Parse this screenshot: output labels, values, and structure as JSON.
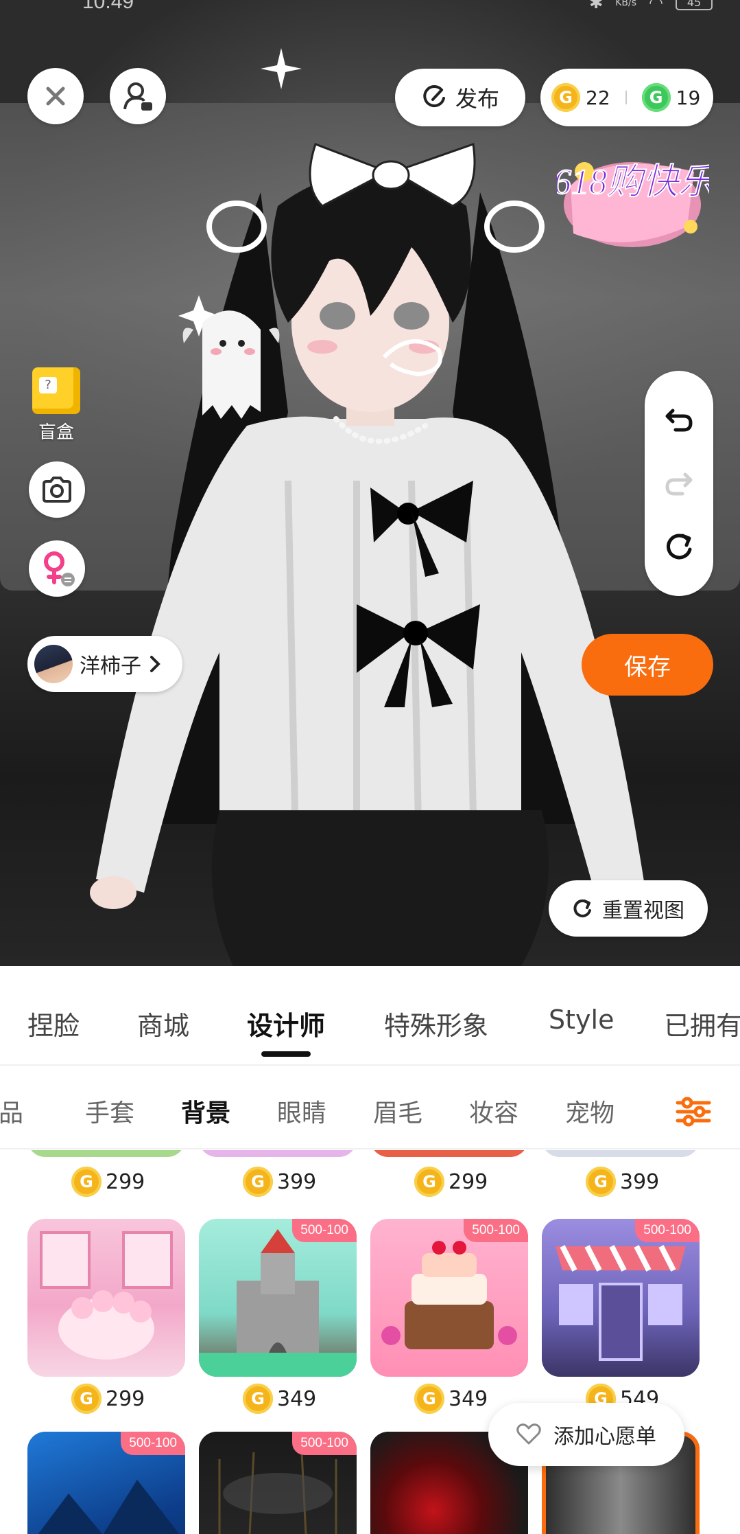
{
  "status_bar": {
    "time": "10:49",
    "net_speed": "KB/s",
    "battery": "45"
  },
  "header": {
    "publish_label": "发布",
    "gold_coins": "22",
    "green_coins": "19",
    "promo_text": "618购快乐"
  },
  "left_tools": {
    "blind_box_label": "盲盒"
  },
  "creator": {
    "name": "洋柿子"
  },
  "actions": {
    "save_label": "保存",
    "reset_view_label": "重置视图"
  },
  "main_tabs": [
    {
      "label": "捏脸"
    },
    {
      "label": "商城"
    },
    {
      "label": "设计师"
    },
    {
      "label": "特殊形象"
    },
    {
      "label": "Style"
    },
    {
      "label": "已拥有"
    }
  ],
  "sub_tabs": [
    {
      "label": "饰品"
    },
    {
      "label": "手套"
    },
    {
      "label": "背景"
    },
    {
      "label": "眼睛"
    },
    {
      "label": "眉毛"
    },
    {
      "label": "妆容"
    },
    {
      "label": "宠物"
    }
  ],
  "grid": {
    "row_prev_prices": [
      "299",
      "399",
      "299",
      "399"
    ],
    "row1": [
      {
        "price": "299",
        "badge": "",
        "theme": "pink-room"
      },
      {
        "price": "349",
        "badge": "500-100",
        "theme": "castle"
      },
      {
        "price": "349",
        "badge": "500-100",
        "theme": "cake"
      },
      {
        "price": "549",
        "badge": "500-100",
        "theme": "cafe"
      }
    ],
    "row2": [
      {
        "badge": "500-100",
        "theme": "blue-mountain"
      },
      {
        "badge": "500-100",
        "theme": "dark-stage"
      },
      {
        "badge": "500",
        "theme": "red-eye"
      },
      {
        "badge": "",
        "theme": "grey-smoke"
      }
    ]
  },
  "wishlist": {
    "label": "添加心愿单"
  },
  "colors": {
    "accent": "#f96d0f",
    "badge": "#fb6f86",
    "gold": "#f4b41a",
    "green": "#3cc85a"
  }
}
